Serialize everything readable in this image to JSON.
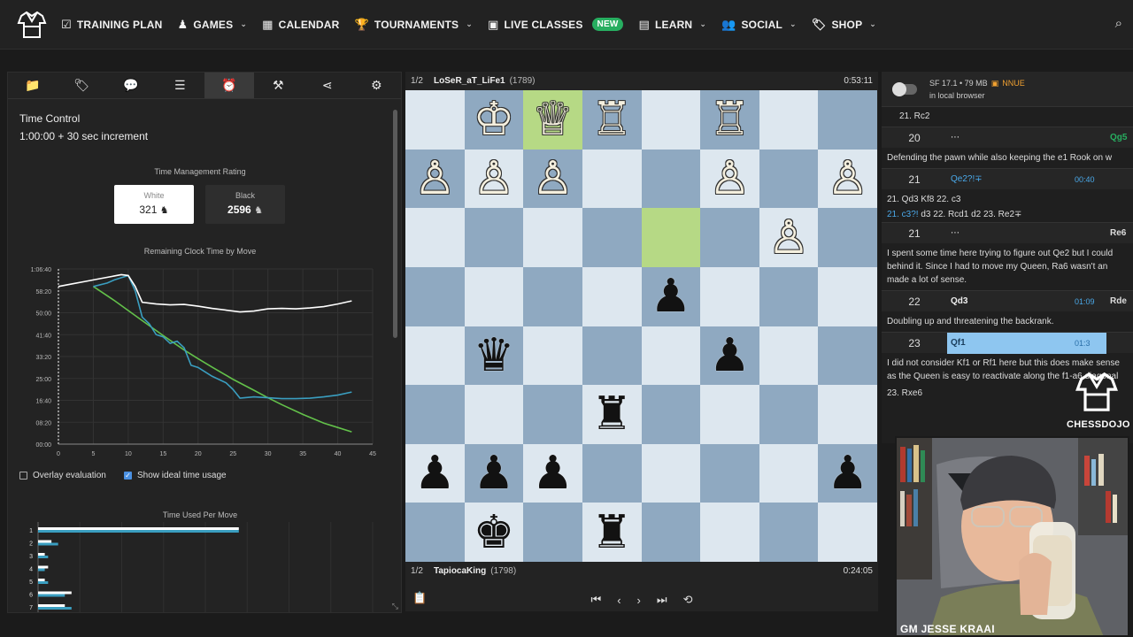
{
  "nav": {
    "items": [
      {
        "label": "TRAINING PLAN",
        "icon": "checklist-icon",
        "glyph": "☑",
        "chevron": false
      },
      {
        "label": "GAMES",
        "icon": "pawn-icon",
        "glyph": "♟",
        "chevron": true
      },
      {
        "label": "CALENDAR",
        "icon": "calendar-icon",
        "glyph": "▦",
        "chevron": false
      },
      {
        "label": "TOURNAMENTS",
        "icon": "trophy-icon",
        "glyph": "🏆",
        "chevron": true
      },
      {
        "label": "LIVE CLASSES",
        "icon": "live-icon",
        "glyph": "▣",
        "chevron": false,
        "badge": "NEW"
      },
      {
        "label": "LEARN",
        "icon": "book-icon",
        "glyph": "▤",
        "chevron": true
      },
      {
        "label": "SOCIAL",
        "icon": "people-icon",
        "glyph": "👥",
        "chevron": true
      },
      {
        "label": "SHOP",
        "icon": "tag-icon",
        "glyph": "🏷",
        "chevron": true
      }
    ]
  },
  "left": {
    "tabs": [
      {
        "icon": "folder-icon",
        "glyph": "📁"
      },
      {
        "icon": "tag-icon",
        "glyph": "🏷"
      },
      {
        "icon": "comment-icon",
        "glyph": "💬"
      },
      {
        "icon": "list-icon",
        "glyph": "☰"
      },
      {
        "icon": "alarm-clock-icon",
        "glyph": "⏰",
        "active": true
      },
      {
        "icon": "tools-icon",
        "glyph": "⚒"
      },
      {
        "icon": "share-icon",
        "glyph": "⋖"
      },
      {
        "icon": "gear-icon",
        "glyph": "⚙"
      }
    ],
    "time_control_title": "Time Control",
    "time_control_value": "1:00:00 + 30 sec increment",
    "tmr_title": "Time Management Rating",
    "white_label": "White",
    "white_value": "321",
    "black_label": "Black",
    "black_value": "2596",
    "chart1_title": "Remaining Clock Time by Move",
    "overlay_label": "Overlay evaluation",
    "overlay_checked": false,
    "ideal_label": "Show ideal time usage",
    "ideal_checked": true,
    "chart2_title": "Time Used Per Move"
  },
  "chart_data": [
    {
      "type": "line",
      "title": "Remaining Clock Time by Move",
      "x_ticks": [
        0,
        5,
        10,
        15,
        20,
        25,
        30,
        35,
        40,
        45
      ],
      "y_ticks": [
        "00:00",
        "08:20",
        "16:40",
        "25:00",
        "33:20",
        "41:40",
        "50:00",
        "58:20",
        "1:06:40"
      ],
      "ylim": [
        0,
        4000
      ],
      "xlim": [
        0,
        45
      ],
      "grid": true,
      "colors": {
        "white": "#ffffff",
        "black": "#3a9ec0",
        "ideal": "#63c14a"
      },
      "series": [
        {
          "x": [
            0,
            2,
            4,
            6,
            8,
            9,
            10,
            11,
            12,
            14,
            16,
            18,
            20,
            22,
            24,
            26,
            28,
            30,
            32,
            34,
            36,
            38,
            40,
            42
          ],
          "y": [
            3600,
            3660,
            3720,
            3780,
            3840,
            3870,
            3850,
            3600,
            3240,
            3200,
            3180,
            3190,
            3150,
            3100,
            3060,
            3020,
            3040,
            3090,
            3100,
            3090,
            3110,
            3140,
            3200,
            3270
          ]
        },
        {
          "x": [
            5,
            7,
            8,
            9,
            10,
            11,
            12,
            13,
            14,
            15,
            16,
            17,
            18,
            19,
            20,
            21,
            22,
            24,
            25,
            26,
            28,
            30,
            32,
            34,
            36,
            38,
            40,
            42
          ],
          "y": [
            3600,
            3680,
            3750,
            3800,
            3850,
            3500,
            2900,
            2750,
            2500,
            2450,
            2300,
            2350,
            2200,
            1800,
            1750,
            1650,
            1550,
            1400,
            1250,
            1050,
            1080,
            1060,
            1040,
            1040,
            1050,
            1080,
            1120,
            1190
          ]
        },
        {
          "x": [
            5,
            8,
            10,
            12,
            15,
            18,
            20,
            22,
            25,
            28,
            30,
            32,
            35,
            38,
            40,
            42
          ],
          "y": [
            3600,
            3280,
            3050,
            2820,
            2480,
            2150,
            1950,
            1760,
            1480,
            1230,
            1060,
            900,
            680,
            480,
            380,
            280
          ]
        }
      ]
    },
    {
      "type": "bar",
      "title": "Time Used Per Move",
      "categories": [
        "1",
        "2",
        "3",
        "4",
        "5",
        "6",
        "7"
      ],
      "series": [
        {
          "values": [
            60,
            4,
            2,
            3,
            2,
            10,
            8
          ]
        },
        {
          "values": [
            60,
            6,
            3,
            2,
            3,
            8,
            10
          ]
        }
      ],
      "xlim": [
        0,
        100
      ]
    }
  ],
  "board": {
    "top_player": {
      "frac": "1/2",
      "name": "LoSeR_aT_LiFe1",
      "rating": "(1789)",
      "clock": "0:53:11"
    },
    "bottom_player": {
      "frac": "1/2",
      "name": "TapiocaKing",
      "rating": "(1798)",
      "clock": "0:24:05"
    },
    "rows": [
      [
        " ",
        "♔",
        "♕",
        "♖",
        " ",
        "♖",
        " ",
        " "
      ],
      [
        "♙",
        "♙",
        "♙",
        " ",
        " ",
        "♙",
        " ",
        "♙"
      ],
      [
        " ",
        " ",
        " ",
        " ",
        " ",
        " ",
        "♙",
        " "
      ],
      [
        " ",
        " ",
        " ",
        " ",
        "♟",
        " ",
        " ",
        " "
      ],
      [
        " ",
        "♛",
        " ",
        " ",
        " ",
        "♟",
        " ",
        " "
      ],
      [
        " ",
        " ",
        " ",
        "♜",
        " ",
        " ",
        " ",
        " "
      ],
      [
        "♟",
        "♟",
        "♟",
        " ",
        " ",
        " ",
        " ",
        "♟"
      ],
      [
        " ",
        "♚",
        " ",
        "♜",
        " ",
        " ",
        " ",
        " "
      ]
    ],
    "highlight": [
      [
        0,
        2
      ],
      [
        2,
        4
      ]
    ],
    "controls": [
      {
        "name": "first-move-button",
        "glyph": "⏮"
      },
      {
        "name": "prev-move-button",
        "glyph": "‹"
      },
      {
        "name": "next-move-button",
        "glyph": "›"
      },
      {
        "name": "last-move-button",
        "glyph": "⏭"
      },
      {
        "name": "flip-board-button",
        "glyph": "⟲"
      }
    ]
  },
  "engine": {
    "line1": "SF 17.1 • 79 MB",
    "nnue": "NNUE",
    "line2": "in local browser"
  },
  "moves": {
    "top_line": "21. Rc2",
    "row20": {
      "num": "20",
      "white": "⋯",
      "black": "Qg5"
    },
    "c20": "Defending the pawn while also keeping the e1 Rook on w",
    "row21a": {
      "num": "21",
      "white": "Qe2?!∓",
      "time": "00:40"
    },
    "v1": "21. Qd3 Kf8 22. c3",
    "v2c": "21. c3?!",
    "v2w": " d3 22. Rcd1 d2 23. Re2∓",
    "row21b": {
      "num": "21",
      "white": "⋯",
      "black": "Re6"
    },
    "c21_1": "I spent some time here trying to figure out Qe2 but I could",
    "c21_2": "behind it. Since I had to move my Queen, Ra6 wasn't an",
    "c21_3": "made a lot of sense.",
    "row22": {
      "num": "22",
      "white": "Qd3",
      "time": "01:09",
      "black": "Rde"
    },
    "c22": "Doubling up and threatening the backrank.",
    "row23": {
      "num": "23",
      "white": "Qf1",
      "time": "01:3"
    },
    "c23_1": "I did not consider Kf1 or Rf1 here but this does make sense",
    "c23_2": "as the Queen is easy to reactivate along the f1-a6 diagonal",
    "c23_3": "23. Rxe6"
  },
  "branding": {
    "logo_text": "CHESSDOJO"
  },
  "webcam": {
    "label": "GM JESSE KRAAI"
  }
}
